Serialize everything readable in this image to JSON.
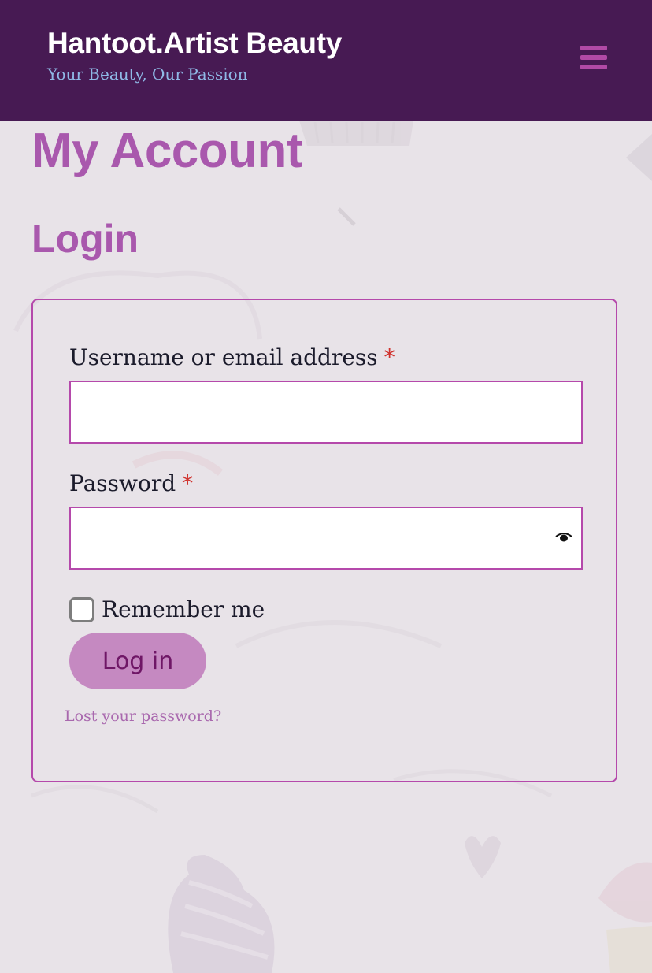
{
  "header": {
    "site_title": "Hantoot.Artist Beauty",
    "tagline": "Your Beauty, Our Passion",
    "menu_icon": "hamburger-menu-icon"
  },
  "page": {
    "title": "My Account",
    "section_title": "Login"
  },
  "login_form": {
    "username_label": "Username or email address",
    "username_value": "",
    "password_label": "Password",
    "password_value": "",
    "required_marker": "*",
    "password_toggle_icon": "eye-icon",
    "remember_label": "Remember me",
    "remember_checked": false,
    "submit_label": "Log in",
    "lost_password_link": "Lost your password?"
  },
  "colors": {
    "header_bg": "#471a53",
    "title_text": "#ffffff",
    "tagline_text": "#8fb9e6",
    "accent": "#a958ad",
    "border": "#b549ab",
    "required": "#d0322d",
    "button_bg": "#c589c1",
    "button_text": "#6f1766",
    "page_bg": "#e8e3e8"
  }
}
